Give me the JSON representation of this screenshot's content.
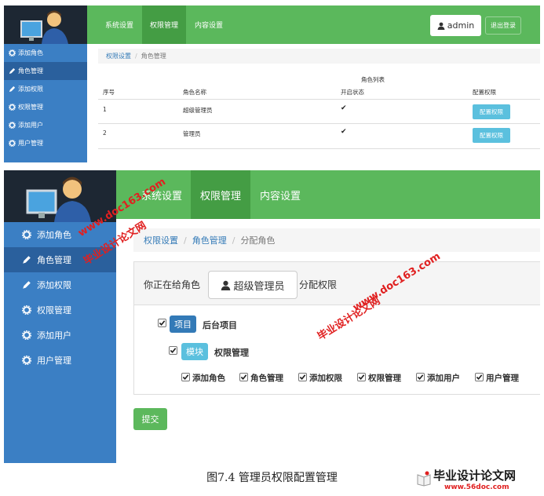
{
  "screen1": {
    "sidebar": [
      "添加角色",
      "角色管理",
      "添加权限",
      "权限管理",
      "添加用户",
      "用户管理"
    ],
    "active_sidebar": 1,
    "nav": [
      "系统设置",
      "权限管理",
      "内容设置"
    ],
    "active_nav": 1,
    "user": "admin",
    "logout": "退出登录",
    "breadcrumb": {
      "parent": "权限设置",
      "current": "角色管理"
    },
    "table": {
      "caption": "角色列表",
      "columns": [
        "序号",
        "角色名称",
        "开启状态",
        "配置权限"
      ],
      "rows": [
        {
          "id": "1",
          "name": "超级管理员",
          "status": "✔",
          "action": "配置权限"
        },
        {
          "id": "2",
          "name": "管理员",
          "status": "✔",
          "action": "配置权限"
        }
      ]
    }
  },
  "screen2": {
    "sidebar": [
      "添加角色",
      "角色管理",
      "添加权限",
      "权限管理",
      "添加用户",
      "用户管理"
    ],
    "active_sidebar": 1,
    "nav": [
      "系统设置",
      "权限管理",
      "内容设置"
    ],
    "active_nav": 1,
    "breadcrumb": {
      "root": "权限设置",
      "parent": "角色管理",
      "current": "分配角色"
    },
    "panel": {
      "lead": "你正在给角色",
      "role": "超级管理员",
      "tail": "分配权限"
    },
    "tree": {
      "project_tag": "项目",
      "project_name": "后台项目",
      "module_tag": "模块",
      "module_name": "权限管理",
      "permissions": [
        "添加角色",
        "角色管理",
        "添加权限",
        "权限管理",
        "添加用户",
        "用户管理"
      ]
    },
    "submit": "提交"
  },
  "watermarks": {
    "site": "www.doc163.com",
    "brand": "毕业设计论文网"
  },
  "caption": "图7.4 管理员权限配置管理",
  "logo": {
    "name": "毕业设计论文网",
    "site": "www.56doc.com"
  },
  "colors": {
    "sidebar": "#3b7fc4",
    "sidebar_active": "#2a609d",
    "topbar": "#5bb85c",
    "topbar_active": "#449d44",
    "info_button": "#5bc0de",
    "primary_tag": "#337ab7",
    "watermark": "#e02020"
  }
}
